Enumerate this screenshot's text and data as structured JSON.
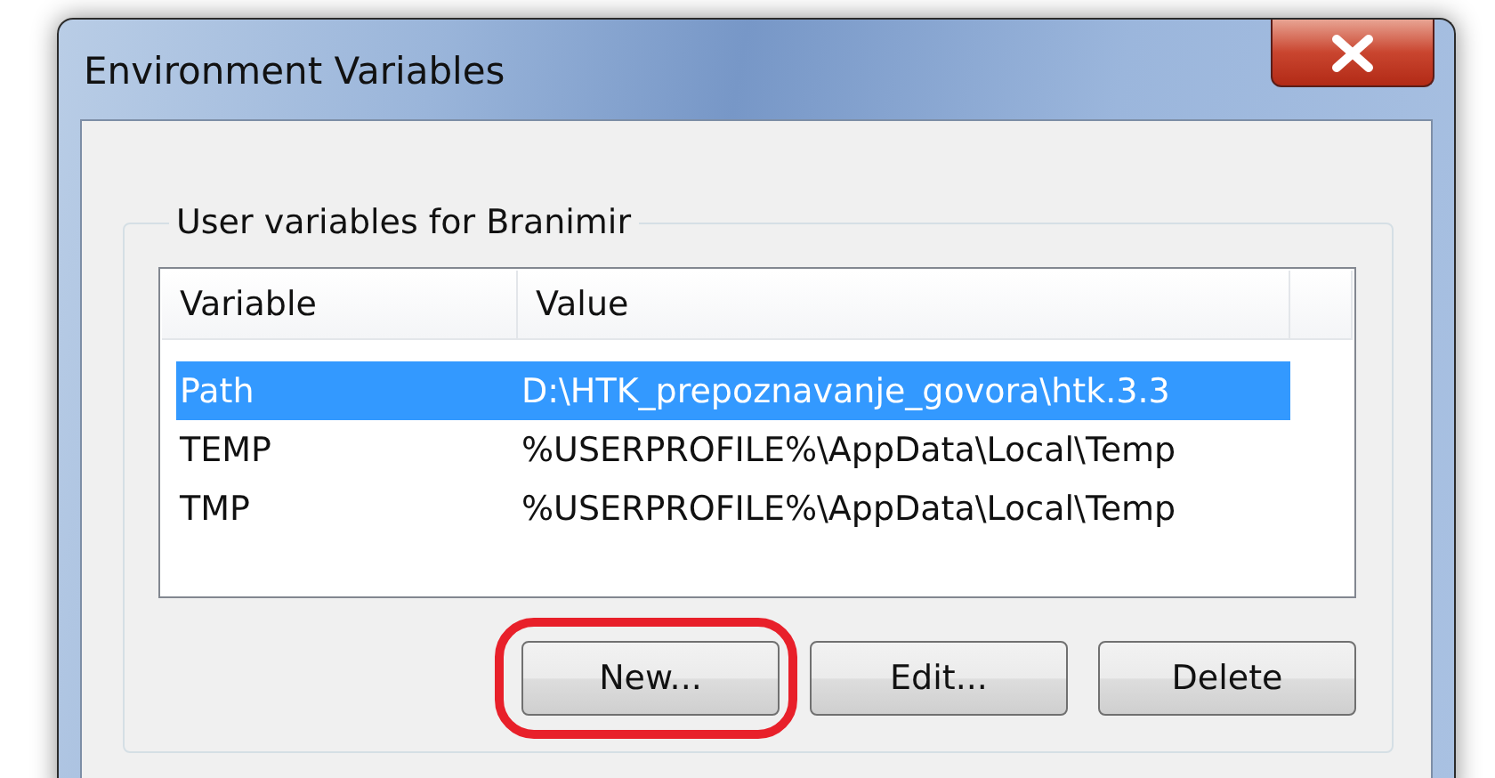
{
  "window": {
    "title": "Environment Variables"
  },
  "group": {
    "label": "User variables for Branimir",
    "columns": [
      "Variable",
      "Value"
    ],
    "rows": [
      {
        "variable": "Path",
        "value": "D:\\HTK_prepoznavanje_govora\\htk.3.3",
        "selected": true
      },
      {
        "variable": "TEMP",
        "value": "%USERPROFILE%\\AppData\\Local\\Temp",
        "selected": false
      },
      {
        "variable": "TMP",
        "value": "%USERPROFILE%\\AppData\\Local\\Temp",
        "selected": false
      }
    ],
    "buttons": [
      {
        "label": "New...",
        "highlighted": true
      },
      {
        "label": "Edit...",
        "highlighted": false
      },
      {
        "label": "Delete",
        "highlighted": false
      }
    ]
  }
}
